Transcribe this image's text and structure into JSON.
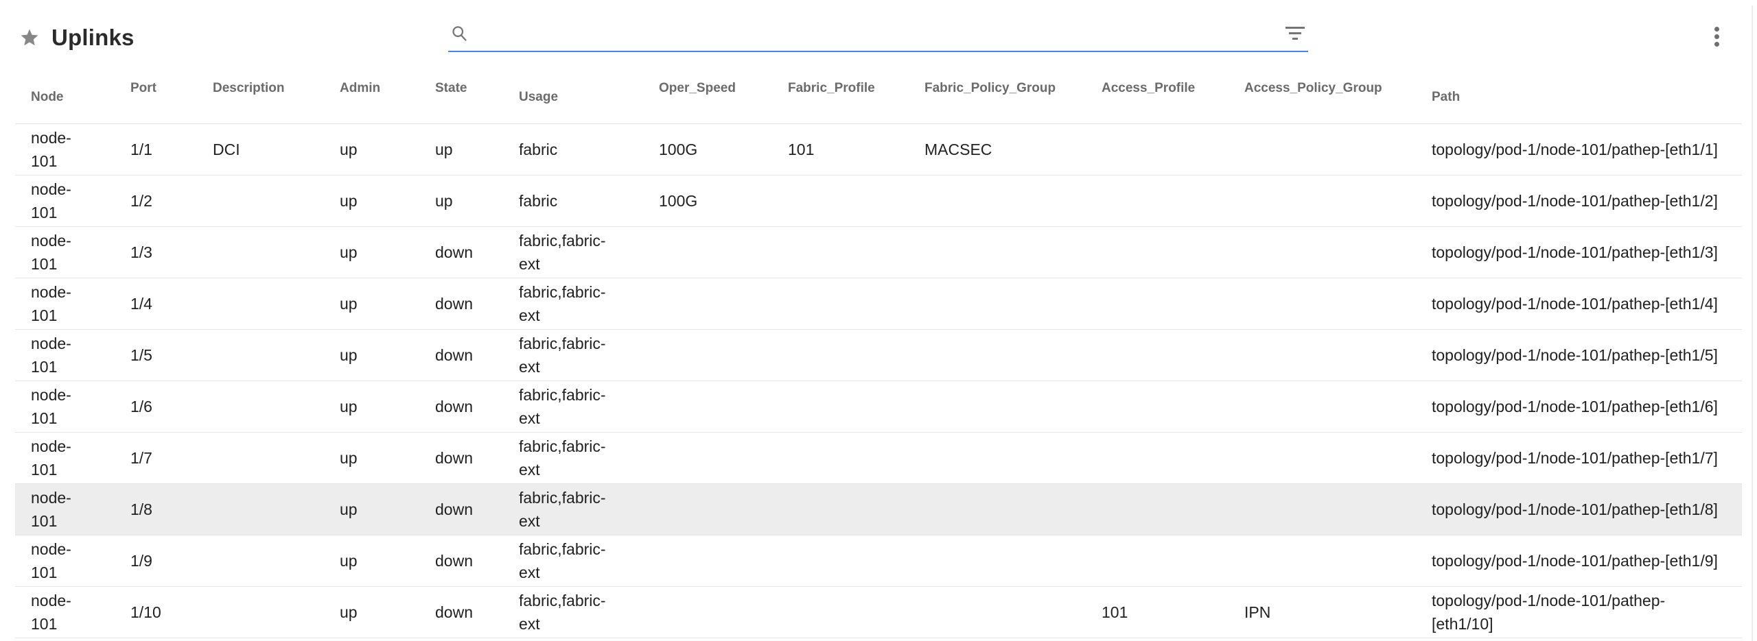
{
  "toolbar": {
    "title": "Uplinks",
    "icons": {
      "title_star": "star-filled",
      "search": "magnifying-glass",
      "filter": "filter-funnel",
      "more": "kebab-vertical-dots"
    },
    "search": {
      "value": "",
      "placeholder": ""
    },
    "accent_color": "#4285f4",
    "icon_color": "#757575"
  },
  "table": {
    "columns": [
      {
        "key": "node",
        "label": "Node",
        "low": true
      },
      {
        "key": "port",
        "label": "Port",
        "low": false
      },
      {
        "key": "description",
        "label": "Description",
        "low": false
      },
      {
        "key": "admin",
        "label": "Admin",
        "low": false
      },
      {
        "key": "state",
        "label": "State",
        "low": false
      },
      {
        "key": "usage",
        "label": "Usage",
        "low": true
      },
      {
        "key": "oper_speed",
        "label": "Oper_Speed",
        "low": false
      },
      {
        "key": "fabric_profile",
        "label": "Fabric_Profile",
        "low": false
      },
      {
        "key": "fabric_policy_group",
        "label": "Fabric_Policy_Group",
        "low": false
      },
      {
        "key": "access_profile",
        "label": "Access_Profile",
        "low": false
      },
      {
        "key": "access_policy_group",
        "label": "Access_Policy_Group",
        "low": false
      },
      {
        "key": "path",
        "label": "Path",
        "low": true
      }
    ],
    "rows": [
      {
        "highlighted": false,
        "cells": {
          "node": "node-101",
          "port": "1/1",
          "description": "DCI",
          "admin": "up",
          "state": "up",
          "usage": "fabric",
          "oper_speed": "100G",
          "fabric_profile": "101",
          "fabric_policy_group": "MACSEC",
          "access_profile": "",
          "access_policy_group": "",
          "path": "topology/pod-1/node-101/pathep-[eth1/1]"
        }
      },
      {
        "highlighted": false,
        "cells": {
          "node": "node-101",
          "port": "1/2",
          "description": "",
          "admin": "up",
          "state": "up",
          "usage": "fabric",
          "oper_speed": "100G",
          "fabric_profile": "",
          "fabric_policy_group": "",
          "access_profile": "",
          "access_policy_group": "",
          "path": "topology/pod-1/node-101/pathep-[eth1/2]"
        }
      },
      {
        "highlighted": false,
        "cells": {
          "node": "node-101",
          "port": "1/3",
          "description": "",
          "admin": "up",
          "state": "down",
          "usage": "fabric,fabric-ext",
          "oper_speed": "",
          "fabric_profile": "",
          "fabric_policy_group": "",
          "access_profile": "",
          "access_policy_group": "",
          "path": "topology/pod-1/node-101/pathep-[eth1/3]"
        }
      },
      {
        "highlighted": false,
        "cells": {
          "node": "node-101",
          "port": "1/4",
          "description": "",
          "admin": "up",
          "state": "down",
          "usage": "fabric,fabric-ext",
          "oper_speed": "",
          "fabric_profile": "",
          "fabric_policy_group": "",
          "access_profile": "",
          "access_policy_group": "",
          "path": "topology/pod-1/node-101/pathep-[eth1/4]"
        }
      },
      {
        "highlighted": false,
        "cells": {
          "node": "node-101",
          "port": "1/5",
          "description": "",
          "admin": "up",
          "state": "down",
          "usage": "fabric,fabric-ext",
          "oper_speed": "",
          "fabric_profile": "",
          "fabric_policy_group": "",
          "access_profile": "",
          "access_policy_group": "",
          "path": "topology/pod-1/node-101/pathep-[eth1/5]"
        }
      },
      {
        "highlighted": false,
        "cells": {
          "node": "node-101",
          "port": "1/6",
          "description": "",
          "admin": "up",
          "state": "down",
          "usage": "fabric,fabric-ext",
          "oper_speed": "",
          "fabric_profile": "",
          "fabric_policy_group": "",
          "access_profile": "",
          "access_policy_group": "",
          "path": "topology/pod-1/node-101/pathep-[eth1/6]"
        }
      },
      {
        "highlighted": false,
        "cells": {
          "node": "node-101",
          "port": "1/7",
          "description": "",
          "admin": "up",
          "state": "down",
          "usage": "fabric,fabric-ext",
          "oper_speed": "",
          "fabric_profile": "",
          "fabric_policy_group": "",
          "access_profile": "",
          "access_policy_group": "",
          "path": "topology/pod-1/node-101/pathep-[eth1/7]"
        }
      },
      {
        "highlighted": true,
        "cells": {
          "node": "node-101",
          "port": "1/8",
          "description": "",
          "admin": "up",
          "state": "down",
          "usage": "fabric,fabric-ext",
          "oper_speed": "",
          "fabric_profile": "",
          "fabric_policy_group": "",
          "access_profile": "",
          "access_policy_group": "",
          "path": "topology/pod-1/node-101/pathep-[eth1/8]"
        }
      },
      {
        "highlighted": false,
        "cells": {
          "node": "node-101",
          "port": "1/9",
          "description": "",
          "admin": "up",
          "state": "down",
          "usage": "fabric,fabric-ext",
          "oper_speed": "",
          "fabric_profile": "",
          "fabric_policy_group": "",
          "access_profile": "",
          "access_policy_group": "",
          "path": "topology/pod-1/node-101/pathep-[eth1/9]"
        }
      },
      {
        "highlighted": false,
        "cells": {
          "node": "node-101",
          "port": "1/10",
          "description": "",
          "admin": "up",
          "state": "down",
          "usage": "fabric,fabric-ext",
          "oper_speed": "",
          "fabric_profile": "",
          "fabric_policy_group": "",
          "access_profile": "101",
          "access_policy_group": "IPN",
          "path": "topology/pod-1/node-101/pathep-[eth1/10]"
        }
      }
    ]
  }
}
